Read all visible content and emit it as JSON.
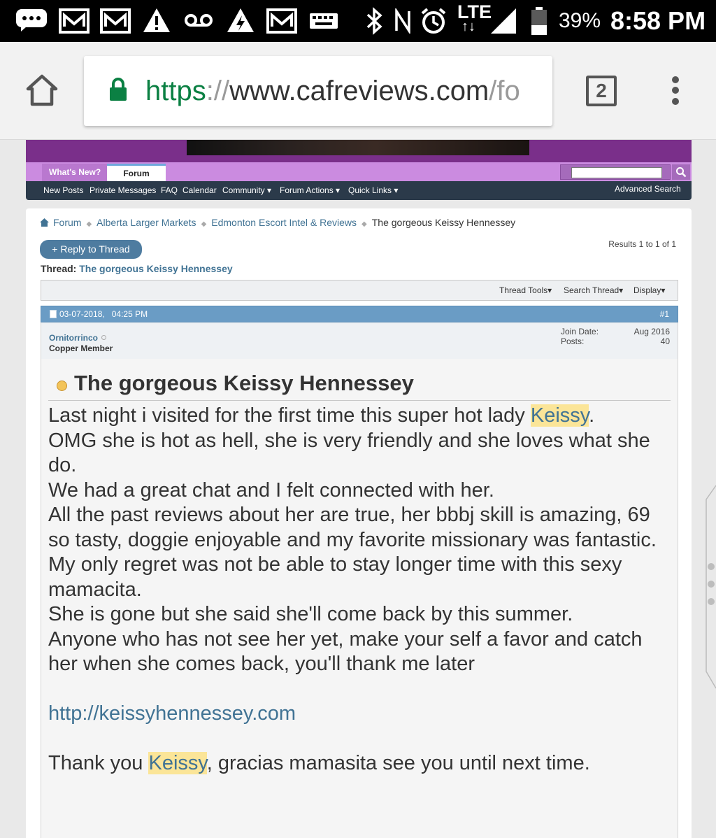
{
  "status_bar": {
    "battery": "39%",
    "time": "8:58 PM",
    "network": "LTE",
    "icons": [
      "chat-bubble-icon",
      "gmail-icon",
      "gmail-icon",
      "warning-icon",
      "voicemail-icon",
      "warning-lightning-icon",
      "gmail-icon",
      "keyboard-icon",
      "bluetooth-icon",
      "nfc-icon",
      "alarm-icon",
      "lte-icon",
      "signal-icon",
      "battery-icon"
    ]
  },
  "browser": {
    "url_scheme": "https",
    "url_sep": "://",
    "url_host": "www.cafreviews.com",
    "url_rest": "/fo",
    "tab_count": "2",
    "home_icon": "home-icon",
    "lock_icon": "lock-icon",
    "menu_icon": "more-vert-icon"
  },
  "forum_nav": {
    "tabs": [
      "What's New?",
      "Forum"
    ],
    "active_tab": "Forum",
    "sub_items": [
      "New Posts",
      "Private Messages",
      "FAQ",
      "Calendar",
      "Community",
      "Forum Actions",
      "Quick Links"
    ],
    "advanced_search": "Advanced Search",
    "search_icon": "search-icon"
  },
  "breadcrumbs": [
    "Forum",
    "Alberta Larger Markets",
    "Edmonton Escort Intel & Reviews",
    "The gorgeous Keissy Hennessey"
  ],
  "reply_button": "+ Reply to Thread",
  "results": "Results 1 to 1 of 1",
  "thread": {
    "label": "Thread:",
    "title": "The gorgeous Keissy Hennessey"
  },
  "thread_tools": [
    "Thread Tools",
    "Search Thread",
    "Display"
  ],
  "post": {
    "date": "03-07-2018,",
    "time": "04:25 PM",
    "number": "#1",
    "username": "Ornitorrinco",
    "user_title": "Copper Member",
    "join_date_label": "Join Date:",
    "join_date": "Aug 2016",
    "posts_label": "Posts:",
    "posts": "40",
    "title": "The gorgeous Keissy Hennessey",
    "body": {
      "line1_pre": "Last night i visited for the first time this super hot lady ",
      "line1_hl": "Keissy",
      "line1_post": ".",
      "p2": "OMG she is hot as hell, she is very friendly and she loves what she do.",
      "p3": "We had a great chat and I felt connected with her.",
      "p4": "All the past reviews about her are true, her bbbj skill is amazing, 69 so tasty, doggie enjoyable and my favorite missionary was fantastic.",
      "p5": "My only regret was not be able to stay longer time with this sexy mamacita.",
      "p6": "She is gone but she said she'll come back by this summer.",
      "p7": "Anyone who has not see her yet, make your self a favor and catch her when she comes back, you'll thank me later",
      "link": "http://keissyhennessey.com",
      "last_pre": "Thank you ",
      "last_hl": "Keissy",
      "last_post": ", gracias mamasita see you until next time."
    }
  }
}
